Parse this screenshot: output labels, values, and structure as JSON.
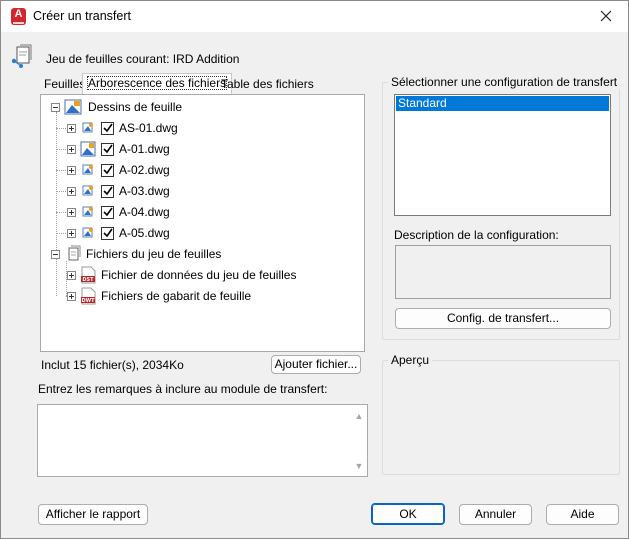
{
  "window": {
    "title": "Créer un transfert",
    "accent": "#d4262c"
  },
  "header": {
    "current_sheetset": "Jeu de feuilles courant: IRD Addition"
  },
  "tabs": [
    {
      "label": "Feuilles",
      "active": false
    },
    {
      "label": "Arborescence des fichiers",
      "active": true
    },
    {
      "label": "Table des fichiers",
      "active": false
    }
  ],
  "tree": {
    "root_sheets": {
      "label": "Dessins de feuille",
      "icon": "sheet-drawings-icon"
    },
    "files": [
      {
        "label": "AS-01.dwg",
        "checked": true,
        "icon": "dwg-file-icon"
      },
      {
        "label": "A-01.dwg",
        "checked": true,
        "icon": "dwg-sheet-icon"
      },
      {
        "label": "A-02.dwg",
        "checked": true,
        "icon": "dwg-file-icon"
      },
      {
        "label": "A-03.dwg",
        "checked": true,
        "icon": "dwg-file-icon"
      },
      {
        "label": "A-04.dwg",
        "checked": true,
        "icon": "dwg-file-icon"
      },
      {
        "label": "A-05.dwg",
        "checked": true,
        "icon": "dwg-file-icon"
      }
    ],
    "root_sheetset": {
      "label": "Fichiers du jeu de feuilles",
      "icon": "sheetset-files-icon"
    },
    "sheetset_children": [
      {
        "label": "Fichier de données du jeu de feuilles",
        "badge": "DST"
      },
      {
        "label": "Fichiers de gabarit de feuille",
        "badge": "DWT"
      }
    ]
  },
  "summary": {
    "included": "Inclut 15 fichier(s), 2034Ko",
    "add_file_button": "Ajouter fichier..."
  },
  "remarks": {
    "label": "Entrez les remarques à inclure au module de transfert:",
    "value": ""
  },
  "config": {
    "group_label": "Sélectionner une configuration de transfert",
    "items": [
      "Standard"
    ],
    "selected": "Standard",
    "description_label": "Description de la configuration:",
    "description_value": "",
    "setup_button": "Config. de transfert..."
  },
  "preview": {
    "label": "Aperçu"
  },
  "footer": {
    "report_button": "Afficher le rapport",
    "ok_button": "OK",
    "cancel_button": "Annuler",
    "help_button": "Aide"
  }
}
